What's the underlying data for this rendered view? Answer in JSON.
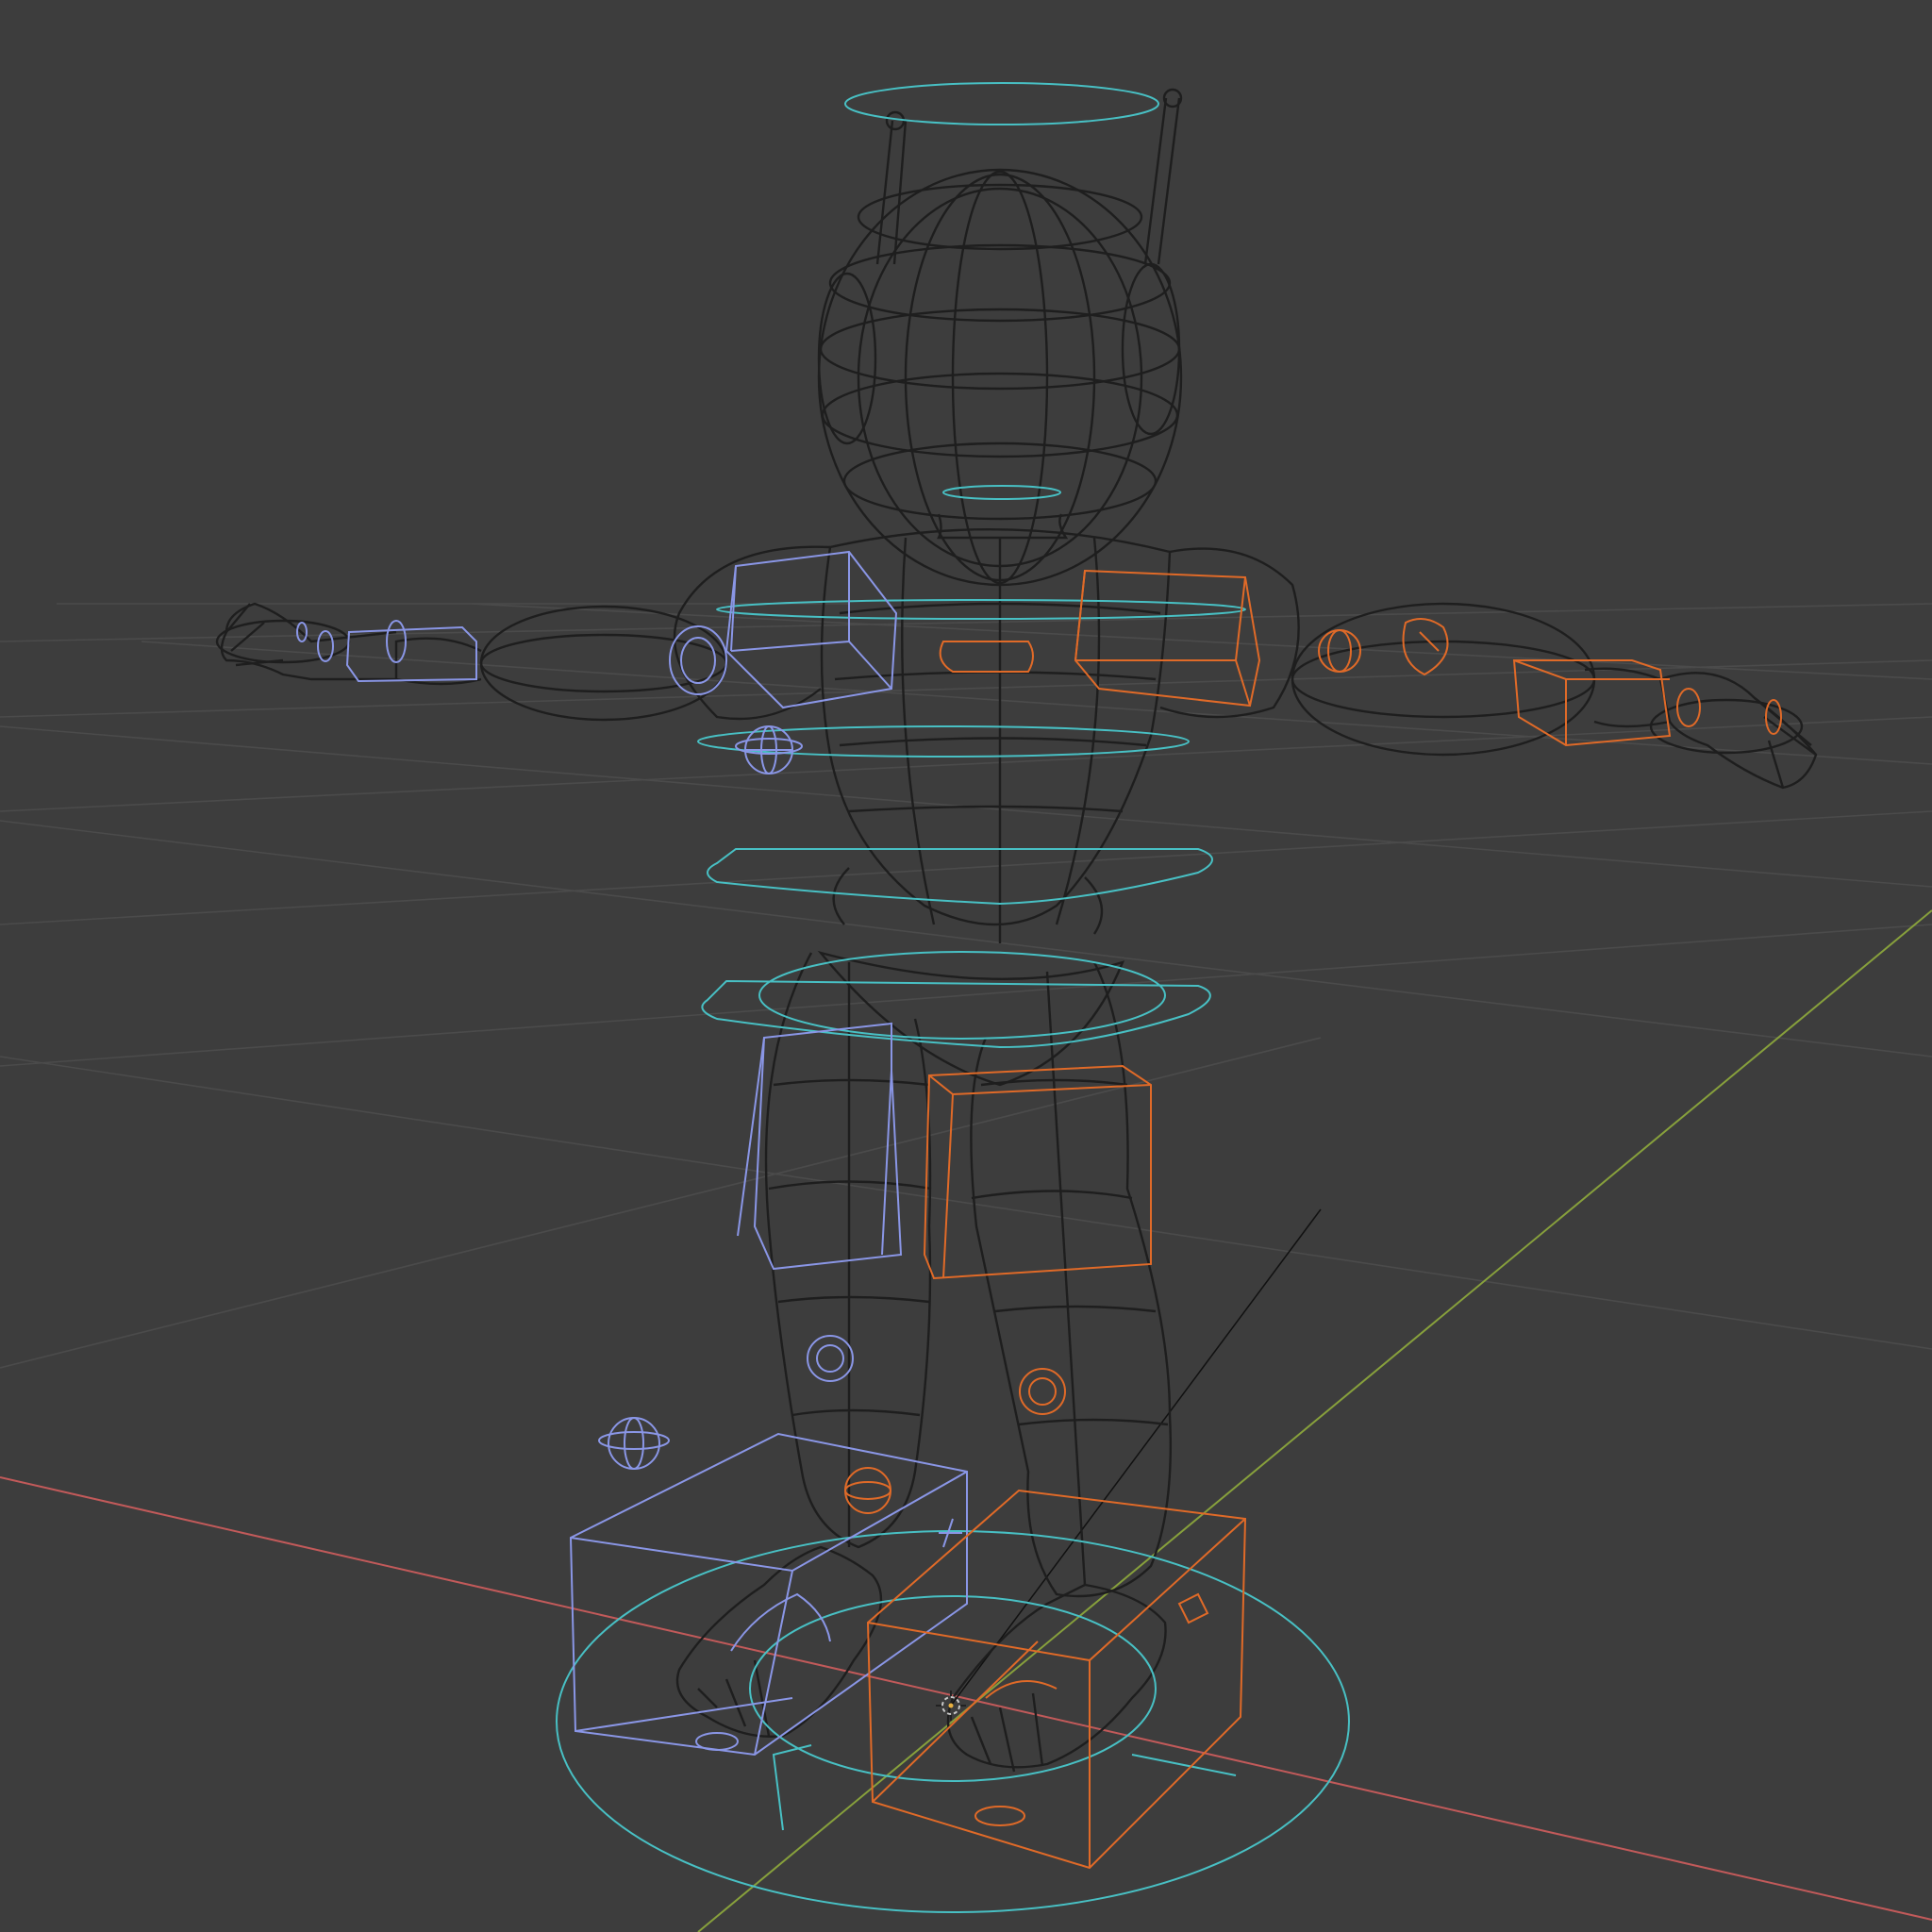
{
  "viewport": {
    "mode": "wireframe",
    "background": "#3d3d3d",
    "grid_color": "#4b4b4b",
    "x_axis_color": "#c25a5a",
    "y_axis_color": "#87a03c",
    "mesh_color": "#1e1e1e",
    "rig_center_color": "#48c0c4",
    "rig_left_color": "#8a96e6",
    "rig_right_color": "#e06a28"
  },
  "icons": {
    "origin": "3d-cursor-icon"
  }
}
